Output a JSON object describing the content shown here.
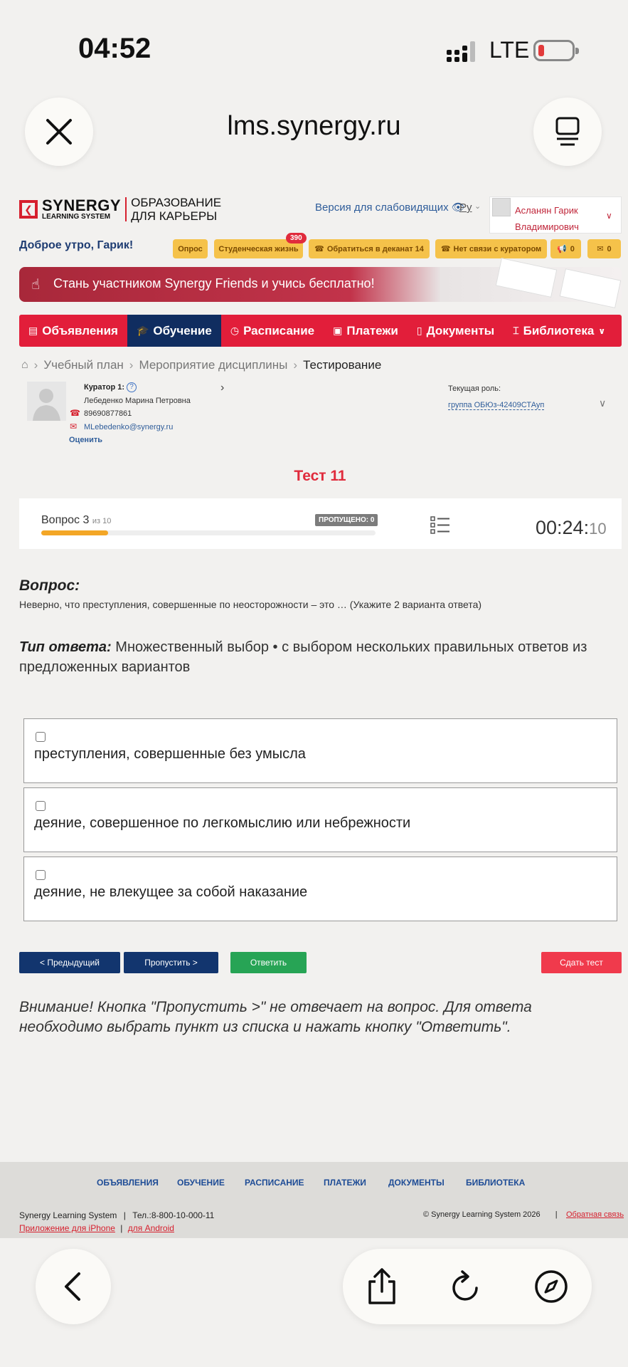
{
  "status_bar": {
    "time": "04:52",
    "network": "LTE"
  },
  "browser": {
    "url": "lms.synergy.ru"
  },
  "header": {
    "logo_main": "SYNERGY",
    "logo_sub": "LEARNING SYSTEM",
    "logo_tagline_1": "ОБРАЗОВАНИЕ",
    "logo_tagline_2": "ДЛЯ КАРЬЕРЫ",
    "accessibility": "Версия для слабовидящих",
    "language": "Ру",
    "user_name_1": "Асланян Гарик",
    "user_name_2": "Владимирович"
  },
  "greeting": "Доброе утро, Гарик!",
  "chips": {
    "survey": "Опрос",
    "student_life": "Студенческая жизнь",
    "student_life_badge": "390",
    "dean": "Обратиться в деканат 14",
    "curator": "Нет связи с куратором",
    "alerts": "0",
    "messages": "0"
  },
  "banner": {
    "text": "Стань участником Synergy Friends и учись бесплатно!"
  },
  "nav": {
    "items": [
      "Объявления",
      "Обучение",
      "Расписание",
      "Платежи",
      "Документы",
      "Библиотека"
    ]
  },
  "breadcrumb": [
    "Учебный план",
    "Мероприятие дисциплины",
    "Тестирование"
  ],
  "curator": {
    "label": "Куратор 1:",
    "name": "Лебеденко Марина Петровна",
    "phone": "89690877861",
    "email": "MLebedenko@synergy.ru",
    "rate": "Оценить"
  },
  "role": {
    "label": "Текущая роль:",
    "value": "группа ОБЮз-42409СТАуп"
  },
  "test": {
    "title": "Тест 11",
    "question_label": "Вопрос 3",
    "question_of": "из 10",
    "skipped": "ПРОПУЩЕНО: 0",
    "progress": 0.2,
    "timer_main": "00:24:",
    "timer_sec": "10"
  },
  "question": {
    "heading": "Вопрос:",
    "text": "Неверно, что преступления, совершенные по неосторожности – это … (Укажите 2 варианта ответа)",
    "type_label": "Тип ответа:",
    "type_value": "Множественный выбор • с выбором нескольких правильных ответов из предложенных вариантов",
    "options": [
      "преступления, совершенные без умысла",
      "деяние, совершенное по легкомыслию или небрежности",
      "деяние, не влекущее за собой наказание"
    ]
  },
  "buttons": {
    "prev": "< Предыдущий",
    "skip": "Пропустить >",
    "answer": "Ответить",
    "finish": "Сдать тест"
  },
  "note": "Внимание! Кнопка \"Пропустить >\" не отвечает на вопрос. Для ответа необходимо выбрать пункт из списка и нажать кнопку \"Ответить\".",
  "footer": {
    "nav": [
      "ОБЪЯВЛЕНИЯ",
      "ОБУЧЕНИЕ",
      "РАСПИСАНИЕ",
      "ПЛАТЕЖИ",
      "ДОКУМЕНТЫ",
      "БИБЛИОТЕКА"
    ],
    "company": "Synergy Learning System",
    "phone": "Тел.:8-800-10-000-11",
    "iphone": "Приложение для iPhone",
    "android": "для Android",
    "copyright": "© Synergy Learning System 2026",
    "feedback": "Обратная связь"
  },
  "colors": {
    "brand_red": "#e21e3a",
    "brand_navy": "#102d60",
    "answer_green": "#27a455",
    "finish_red": "#f03a4c"
  }
}
